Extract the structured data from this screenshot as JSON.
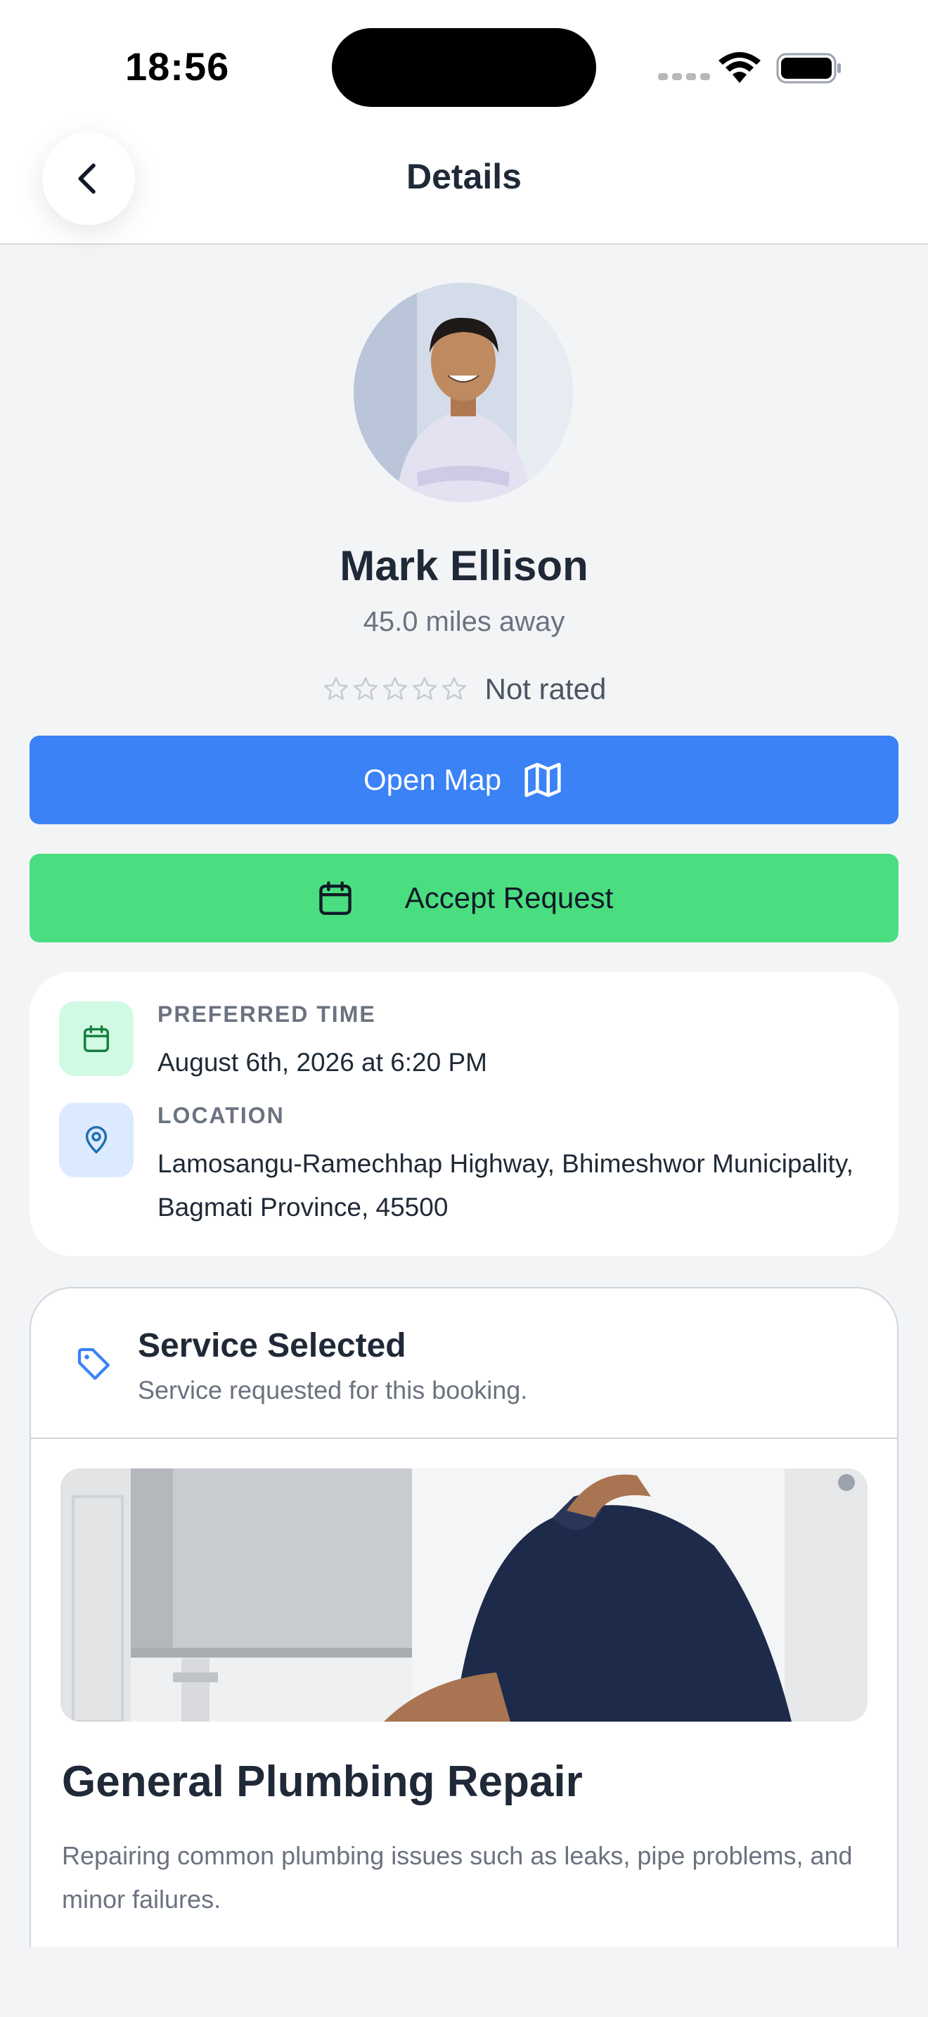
{
  "status_bar": {
    "time": "18:56"
  },
  "header": {
    "title": "Details",
    "back_icon": "chevron-left-icon"
  },
  "profile": {
    "name": "Mark Ellison",
    "distance": "45.0 miles away",
    "rating_text": "Not rated",
    "rating_stars": 0,
    "stars_total": 5
  },
  "actions": {
    "open_map_label": "Open Map",
    "open_map_icon": "map-icon",
    "accept_label": "Accept Request",
    "accept_icon": "calendar-icon"
  },
  "info": {
    "preferred_time_label": "PREFERRED TIME",
    "preferred_time_value": "August 6th, 2026 at 6:20 PM",
    "location_label": "LOCATION",
    "location_value": "Lamosangu-Ramechhap Highway, Bhimeshwor Municipality, Bagmati Province, 45500"
  },
  "service": {
    "section_title": "Service Selected",
    "section_subtitle": "Service requested for this booking.",
    "name": "General Plumbing Repair",
    "description": "Repairing common plumbing issues such as leaks, pipe problems, and minor failures."
  },
  "colors": {
    "primary_blue": "#3b82f6",
    "accept_green": "#4ade80",
    "background": "#f3f4f6",
    "text_dark": "#1f2937",
    "text_muted": "#6b7280"
  }
}
